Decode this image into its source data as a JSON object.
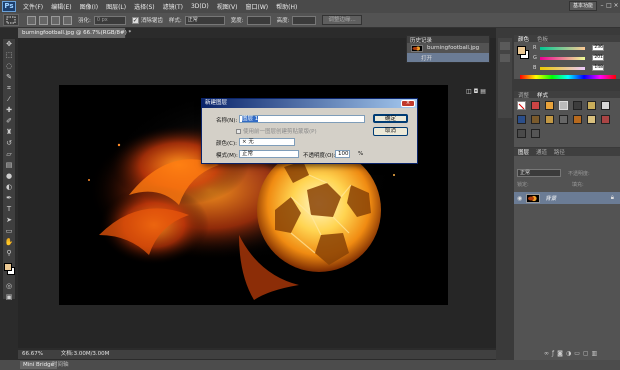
{
  "menubar": {
    "logo": "Ps",
    "items": [
      "文件(F)",
      "编辑(E)",
      "图像(I)",
      "图层(L)",
      "选择(S)",
      "滤镜(T)",
      "3D(D)",
      "视图(V)",
      "窗口(W)",
      "帮助(H)"
    ],
    "workspace": "基本功能",
    "window_controls": [
      "–",
      "□",
      "×"
    ]
  },
  "options": {
    "feather_label": "羽化:",
    "feather_value": "0 px",
    "antialias_label": "消除锯齿",
    "style_label": "样式:",
    "style_value": "正常",
    "width_label": "宽度:",
    "height_label": "高度:",
    "refine_label": "调整边缘..."
  },
  "document": {
    "tab": "burningfootball.jpg @ 66.7%(RGB/8#) *",
    "zoom": "66.67%",
    "doc_info": "文档:3.00M/3.00M"
  },
  "dialog": {
    "title": "新建图层",
    "close": "×",
    "name_label": "名称(N):",
    "name_value": "图层 1",
    "clip_label": "使用前一图层创建剪贴蒙版(P)",
    "color_label": "颜色(C):",
    "color_value": "× 无",
    "mode_label": "模式(M):",
    "mode_value": "正常",
    "opacity_label": "不透明度(O):",
    "opacity_value": "100",
    "opacity_unit": "%",
    "ok": "确定",
    "cancel": "取消"
  },
  "history": {
    "tabs": [
      "历史记录"
    ],
    "snapshot": "burningfootball.jpg",
    "step": "打开"
  },
  "color_panel": {
    "tabs": [
      "颜色",
      "色板"
    ],
    "channels": [
      {
        "label": "R",
        "value": "236"
      },
      {
        "label": "G",
        "value": "201"
      },
      {
        "label": "B",
        "value": "148"
      }
    ],
    "fg_color": "#ecc994",
    "bg_color": "#ffffff"
  },
  "adjust_panel": {
    "tabs": [
      "调整",
      "样式"
    ]
  },
  "layers_panel": {
    "tabs": [
      "图层",
      "通道",
      "路径"
    ],
    "blend_mode": "正常",
    "opacity_label": "不透明度:",
    "lock_label": "锁定:",
    "fill_label": "填充:",
    "layer_name": "背景"
  },
  "bridge": {
    "tabs": [
      "Mini Bridge",
      "时间轴"
    ]
  },
  "icons": [
    "move-icon",
    "marquee-icon",
    "lasso-icon",
    "quick-select-icon",
    "crop-icon",
    "eyedropper-icon",
    "healing-icon",
    "brush-icon",
    "stamp-icon",
    "history-brush-icon",
    "eraser-icon",
    "gradient-icon",
    "blur-icon",
    "dodge-icon",
    "pen-icon",
    "type-icon",
    "path-select-icon",
    "shape-icon",
    "hand-icon",
    "zoom-icon"
  ]
}
